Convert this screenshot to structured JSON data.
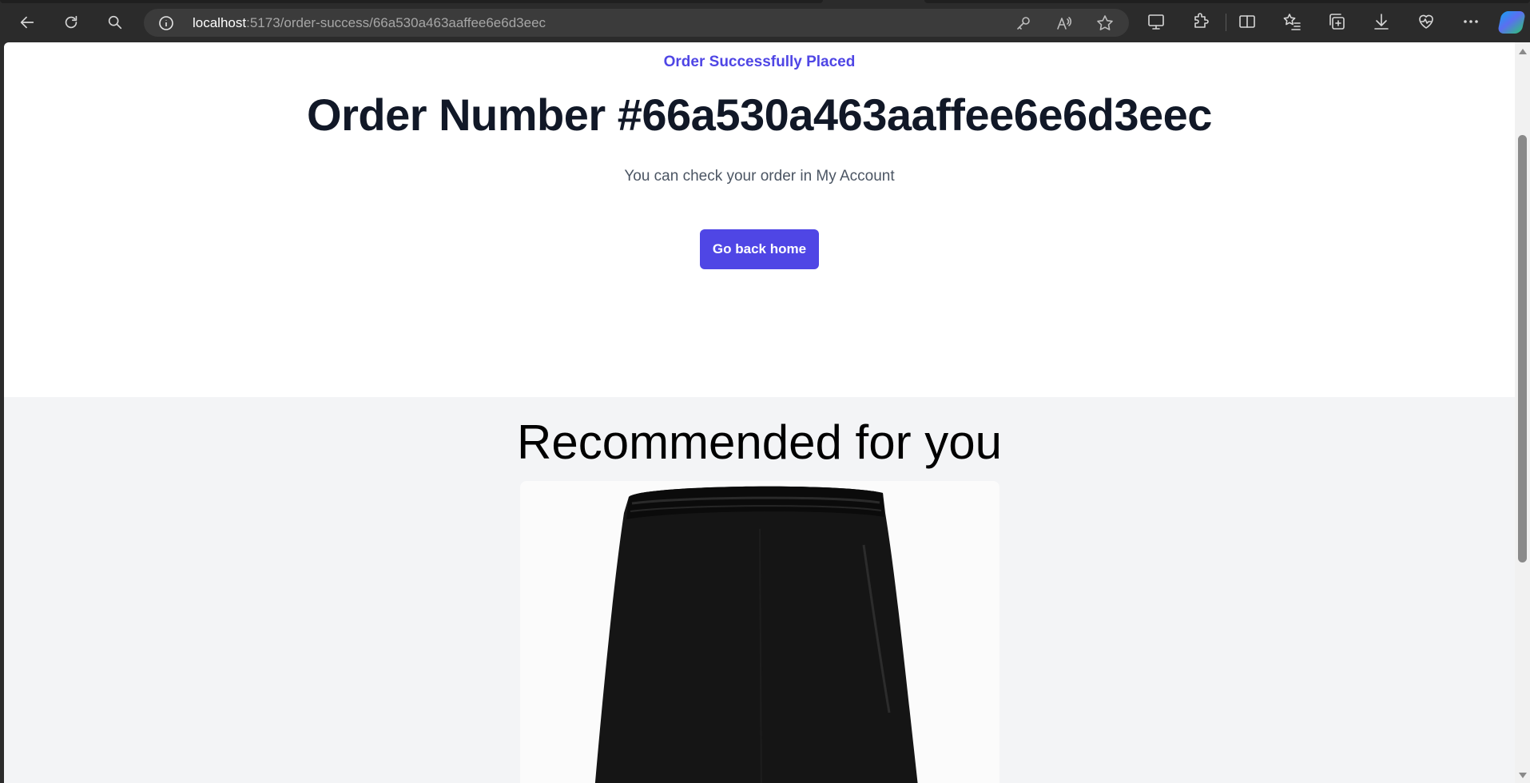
{
  "browser": {
    "url_host": "localhost",
    "url_rest": ":5173/order-success/66a530a463aaffee6e6d3eec",
    "icons": [
      "back-icon",
      "refresh-icon",
      "search-icon",
      "site-info-icon",
      "key-icon",
      "read-aloud-icon",
      "favorite-star-icon",
      "screen-cast-icon",
      "extensions-icon",
      "split-screen-icon",
      "favorites-icon",
      "collections-icon",
      "downloads-icon",
      "browser-essentials-icon",
      "more-icon",
      "copilot-icon"
    ]
  },
  "page": {
    "success_label": "Order Successfully Placed",
    "order_number": "Order Number #66a530a463aaffee6e6d3eec",
    "account_note": "You can check your order in My Account",
    "home_button": "Go back home",
    "recommended_title": "Recommended for you"
  },
  "colors": {
    "accent": "#4f46e5",
    "heading": "#111827",
    "muted": "#4b5563",
    "section_bg": "#f3f4f6"
  }
}
